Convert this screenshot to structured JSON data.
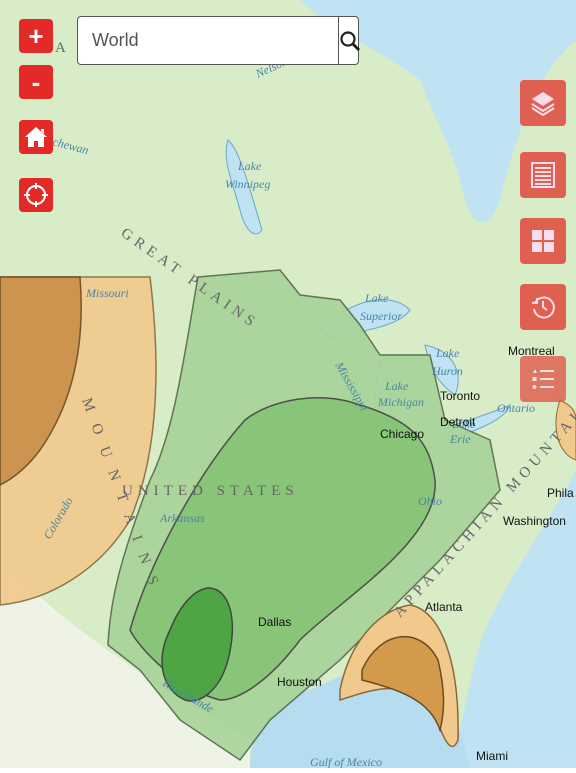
{
  "search": {
    "value": "World",
    "search_icon": "magnifier-icon"
  },
  "left_controls": [
    {
      "label": "+",
      "icon": "zoom-in-icon"
    },
    {
      "label": "-",
      "icon": "zoom-out-icon"
    },
    {
      "icon": "home-icon"
    },
    {
      "icon": "locate-icon"
    }
  ],
  "right_controls": [
    "layers-icon",
    "list-icon",
    "basemap-grid-icon",
    "history-icon",
    "legend-icon"
  ],
  "colors": {
    "button_red": "#e32a26",
    "right_button": "#e0594a",
    "green_light": "#a9d49a",
    "green_mid": "#7fbf6e",
    "green_dark": "#4ea544",
    "orange_light": "#f2c98c",
    "orange_dark": "#d49a4c",
    "water": "#bfe3f2"
  },
  "map_labels": {
    "canada": "A N",
    "nelson": "Nelson",
    "saskatchewan": "chewan",
    "lake_winnipeg_1": "Lake",
    "lake_winnipeg_2": "Winnipeg",
    "great_plains": "GREAT PLAINS",
    "missouri": "Missouri",
    "lake_superior_1": "Lake",
    "lake_superior_2": "Superior",
    "lake_huron_1": "Lake",
    "lake_huron_2": "Huron",
    "lake_michigan_1": "Lake",
    "lake_michigan_2": "Michigan",
    "mississippi": "Mississippi",
    "lake_erie_1": "Lake",
    "lake_erie_2": "Erie",
    "lake_ontario": "Ontario",
    "united_states": "UNITED STATES",
    "arkansas": "Arkansas",
    "colorado": "Colorado",
    "ohio": "Ohio",
    "rocky": "M O U N T A I N S",
    "appalachian": "APPALACHIAN MOUNTAINS",
    "rio_grande": "Rio Grande",
    "gulf": "Gulf of Mexico",
    "cities": {
      "montreal": "Montreal",
      "toronto": "Toronto",
      "detroit": "Detroit",
      "chicago": "Chicago",
      "philadelphia": "Phila",
      "washington": "Washington",
      "atlanta": "Atlanta",
      "dallas": "Dallas",
      "houston": "Houston",
      "miami": "Miami"
    }
  }
}
